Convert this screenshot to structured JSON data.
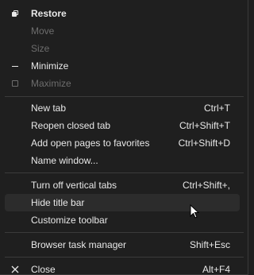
{
  "window_controls": {
    "restore": "Restore",
    "move": "Move",
    "size": "Size",
    "minimize": "Minimize",
    "maximize": "Maximize"
  },
  "tab_actions": {
    "new_tab": {
      "label": "New tab",
      "shortcut": "Ctrl+T"
    },
    "reopen_closed_tab": {
      "label": "Reopen closed tab",
      "shortcut": "Ctrl+Shift+T"
    },
    "add_to_favorites": {
      "label": "Add open pages to favorites",
      "shortcut": "Ctrl+Shift+D"
    },
    "name_window": {
      "label": "Name window..."
    }
  },
  "layout_actions": {
    "vertical_tabs": {
      "label": "Turn off vertical tabs",
      "shortcut": "Ctrl+Shift+,"
    },
    "hide_title_bar": {
      "label": "Hide title bar"
    },
    "customize_toolbar": {
      "label": "Customize toolbar"
    }
  },
  "tools": {
    "task_manager": {
      "label": "Browser task manager",
      "shortcut": "Shift+Esc"
    }
  },
  "close": {
    "label": "Close",
    "shortcut": "Alt+F4"
  }
}
